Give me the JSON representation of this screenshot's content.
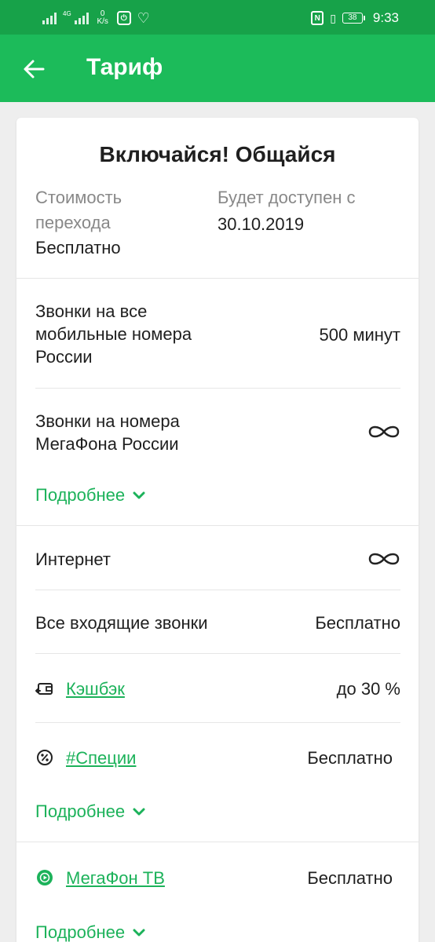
{
  "status_bar": {
    "network_label": "4G",
    "speed_value": "0",
    "speed_unit": "K/s",
    "battery": "38",
    "time": "9:33"
  },
  "app_bar": {
    "title": "Тариф"
  },
  "tariff": {
    "name": "Включайся! Общайся",
    "transition_cost_label": "Стоимость перехода",
    "transition_cost_value": "Бесплатно",
    "available_from_label": "Будет доступен с",
    "available_from_value": "30.10.2019"
  },
  "features": {
    "calls_mobile": {
      "label": "Звонки на все мобильные номера России",
      "value": "500 минут"
    },
    "calls_megafon": {
      "label": "Звонки на номера МегаФона России",
      "value_icon": "infinity-icon"
    },
    "more_1": "Подробнее",
    "internet": {
      "label": "Интернет",
      "value_icon": "infinity-icon"
    },
    "incoming_calls": {
      "label": "Все входящие звонки",
      "value": "Бесплатно"
    },
    "cashback": {
      "label": "Кэшбэк",
      "value": "до 30 %"
    },
    "spices": {
      "label": "#Специи",
      "value": "Бесплатно"
    },
    "more_2": "Подробнее",
    "megafon_tv": {
      "label": "МегаФон ТВ",
      "value": "Бесплатно"
    },
    "more_3": "Подробнее"
  },
  "colors": {
    "status_bar": "#17a249",
    "app_bar": "#1cbb5a",
    "accent_green": "#1cb25a",
    "background": "#eeeeee"
  }
}
